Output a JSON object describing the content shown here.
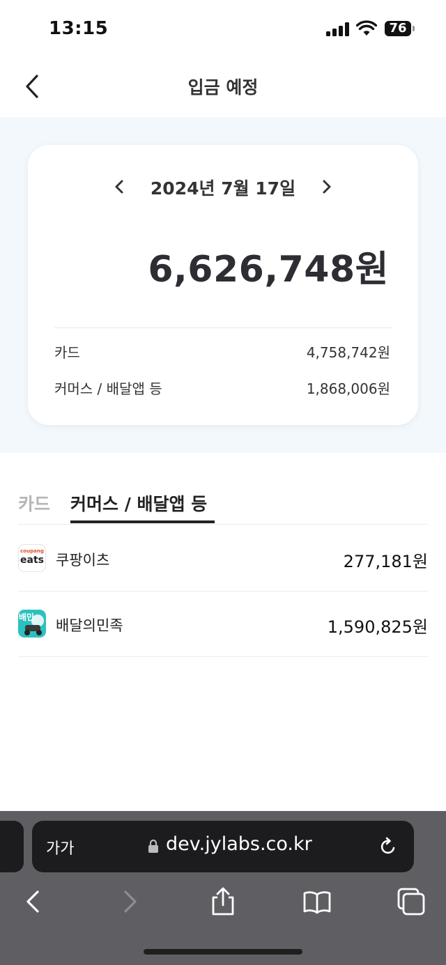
{
  "status_bar": {
    "time": "13:15",
    "battery": "76"
  },
  "header": {
    "title": "입금 예정"
  },
  "summary": {
    "date": "2024년 7월 17일",
    "total": "6,626,748원",
    "rows": [
      {
        "label": "카드",
        "value": "4,758,742원"
      },
      {
        "label": "커머스 / 배달앱 등",
        "value": "1,868,006원"
      }
    ]
  },
  "tabs": [
    {
      "label": "카드",
      "active": false
    },
    {
      "label": "커머스 / 배달앱 등",
      "active": true
    }
  ],
  "list": [
    {
      "name": "쿠팡이츠",
      "amount": "277,181원",
      "logo_text_top": "coupang",
      "logo_text_bottom": "eats"
    },
    {
      "name": "배달의민족",
      "amount": "1,590,825원",
      "logo_text": "배민"
    }
  ],
  "browser": {
    "aa_label": "가가",
    "url": "dev.jylabs.co.kr"
  },
  "colors": {
    "summary_background": "#f2f8fc",
    "inactive_tab": "#b5b5b5",
    "browser_bar": "#5f5f63",
    "url_bar": "#1c1c1e",
    "baemin_teal": "#2cc1c0",
    "coupang_orange": "#e0502b"
  }
}
